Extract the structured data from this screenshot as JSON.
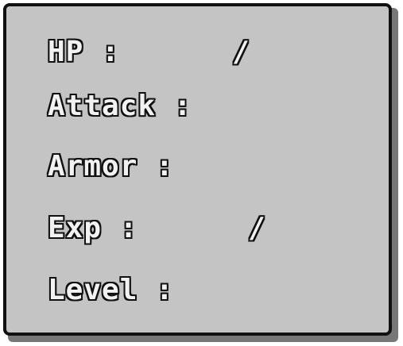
{
  "stats_panel": {
    "hp": {
      "label": "HP :",
      "separator": "/"
    },
    "attack": {
      "label": "Attack :"
    },
    "armor": {
      "label": "Armor :"
    },
    "exp": {
      "label": "Exp :",
      "separator": "/"
    },
    "level": {
      "label": "Level :"
    }
  }
}
